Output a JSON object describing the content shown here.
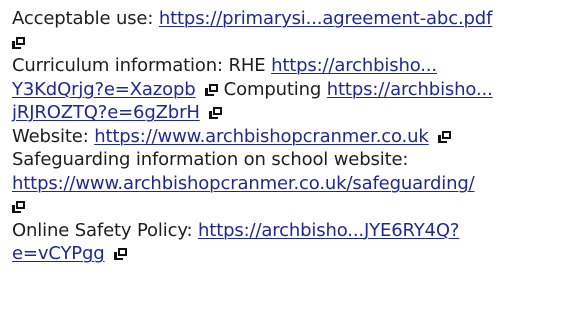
{
  "items": [
    {
      "label": "Acceptable use:",
      "link": "https://primarysi...agreement-abc.pdf"
    },
    {
      "label": "Curriculum information: RHE",
      "link_line1": "https://archbisho...",
      "link_line2": "Y3KdQrjg?e=Xazopb"
    },
    {
      "label": "Computing",
      "link_line1": "https://archbisho...",
      "link_line2": "jRJROZTQ?e=6gZbrH"
    },
    {
      "label": "Website:",
      "link": "https://www.archbishopcranmer.co.uk"
    },
    {
      "label": "Safeguarding information on school website:",
      "link": "https://www.archbishopcranmer.co.uk/safeguarding/"
    },
    {
      "label": "Online Safety Policy:",
      "link_line1": "https://archbisho...JYE6RY4Q?",
      "link_line2": "e=vCYPgg"
    }
  ],
  "icons": {
    "external_link": "open-in-new-window-icon"
  },
  "colors": {
    "text": "#1e1e1e",
    "link": "#1f2b8c",
    "icon": "#111111"
  }
}
